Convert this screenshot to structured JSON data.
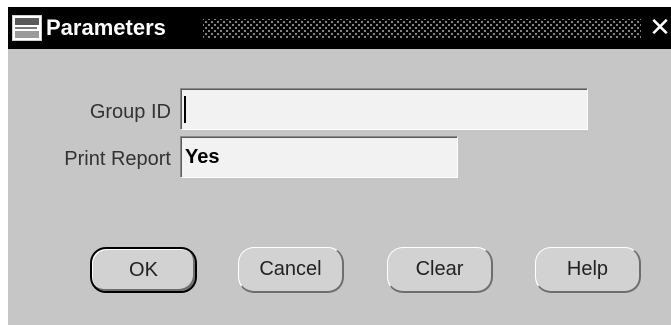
{
  "window": {
    "title": "Parameters",
    "app_icon": "oracle-applications-icon",
    "close_symbol": "✕"
  },
  "fields": {
    "group_id": {
      "label": "Group ID",
      "value": ""
    },
    "print_report": {
      "label": "Print Report",
      "value": "Yes"
    }
  },
  "buttons": {
    "ok": "OK",
    "cancel": "Cancel",
    "clear": "Clear",
    "help": "Help"
  },
  "colors": {
    "titlebar": "#000000",
    "dialog_background": "#c6c6c6",
    "field_background": "#f2f2f2"
  }
}
